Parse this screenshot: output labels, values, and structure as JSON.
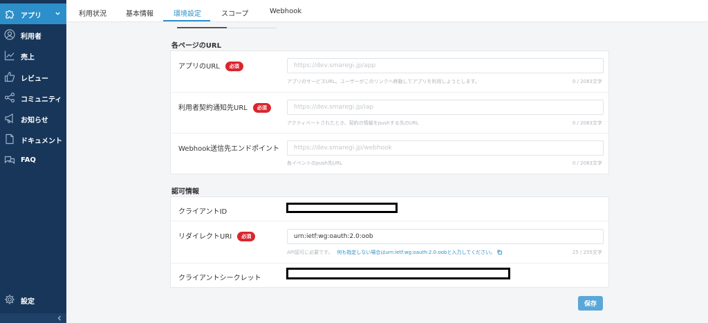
{
  "sidebar": {
    "items": [
      {
        "label": "アプリ",
        "icon": "puzzle-icon",
        "active": true
      },
      {
        "label": "利用者",
        "icon": "user-icon"
      },
      {
        "label": "売上",
        "icon": "chart-line-icon"
      },
      {
        "label": "レビュー",
        "icon": "thumbs-up-icon"
      },
      {
        "label": "コミュニティ",
        "icon": "share-icon"
      },
      {
        "label": "お知らせ",
        "icon": "megaphone-icon"
      },
      {
        "label": "ドキュメント",
        "icon": "document-icon"
      },
      {
        "label": "FAQ",
        "icon": "chat-icon"
      }
    ],
    "settings": {
      "label": "設定",
      "icon": "gear-icon"
    }
  },
  "tabs": [
    {
      "label": "利用状況"
    },
    {
      "label": "基本情報"
    },
    {
      "label": "環境設定",
      "active": true
    },
    {
      "label": "スコープ"
    },
    {
      "label": "Webhook"
    }
  ],
  "url_section": {
    "title": "各ページのURL",
    "required_badge": "必須",
    "rows": [
      {
        "label": "アプリのURL",
        "required": true,
        "placeholder": "https://dev.smaregi.jp/app",
        "value": "",
        "help": "アプリのサービスURL。ユーザーがこのリンクへ移動してアプリを利用しようとします。",
        "counter": "0 / 2083文字"
      },
      {
        "label": "利用者契約通知先URL",
        "required": true,
        "placeholder": "https://dev.smaregi.jp/iap",
        "value": "",
        "help": "アクティベートされたとき、契約の情報をpushする先のURL",
        "counter": "0 / 2083文字"
      },
      {
        "label": "Webhook送信先エンドポイント",
        "required": false,
        "placeholder": "https://dev.smaregi.jp/webhook",
        "value": "",
        "help": "各イベントのpush先URL",
        "counter": "0 / 2083文字"
      }
    ]
  },
  "auth_section": {
    "title": "認可情報",
    "client_id_label": "クライアントID",
    "redirect_label": "リダイレクトURI",
    "redirect_value": "urn:ietf:wg:oauth:2.0:oob",
    "redirect_help": "API認可に必要です。",
    "redirect_link": "何も指定しない場合はurn:ietf:wg:oauth:2.0:oobと入力してください。",
    "redirect_counter": "25 / 255文字",
    "secret_label": "クライアントシークレット"
  },
  "save_label": "保存",
  "colors": {
    "sidebar": "#17365a",
    "accent": "#2c8fc9",
    "required": "#d9262e",
    "save": "#5aa7d8"
  }
}
